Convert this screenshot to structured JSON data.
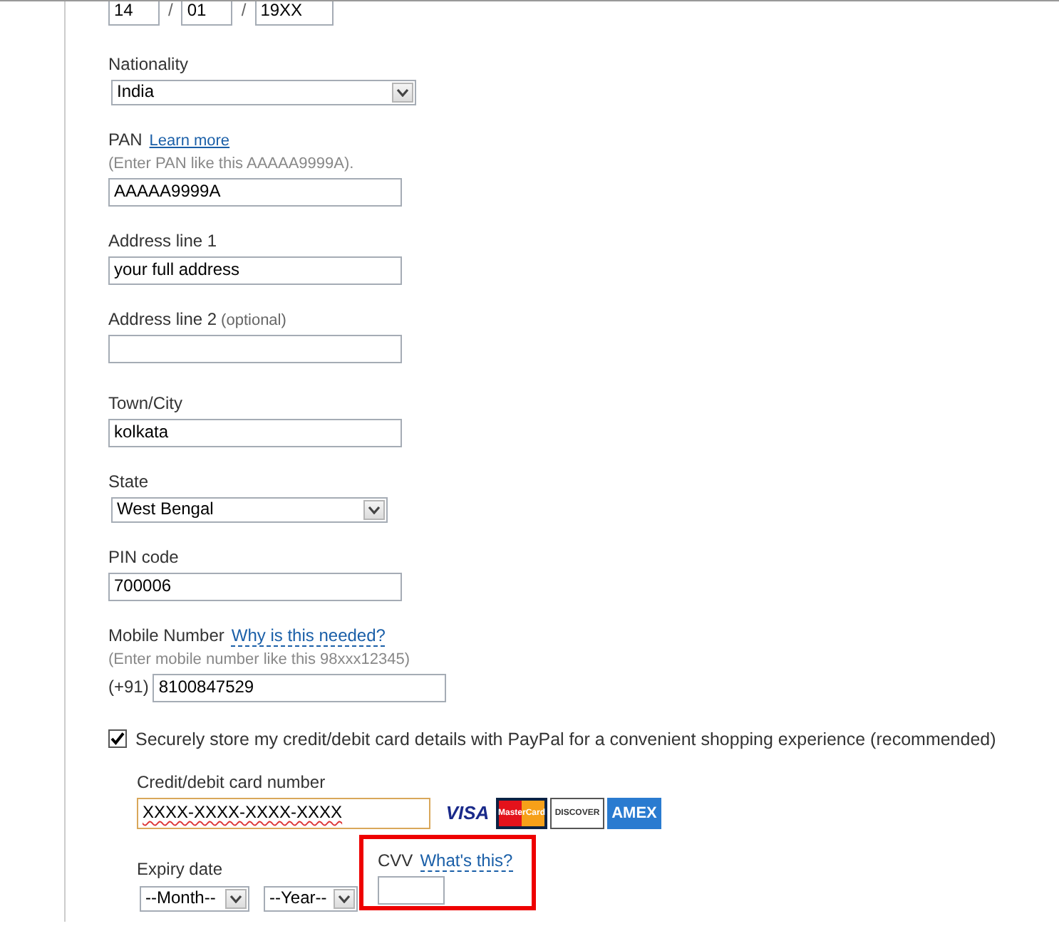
{
  "date_of_birth": {
    "day": "14",
    "month": "01",
    "year": "19XX",
    "separators": [
      "/",
      "/"
    ]
  },
  "fields": [
    {
      "kind": "select",
      "label": "Nationality",
      "value": "India"
    },
    {
      "kind": "text",
      "label": "PAN",
      "link": "Learn more",
      "hint": "(Enter PAN like this AAAAA9999A).",
      "value": "AAAAA9999A"
    },
    {
      "kind": "text",
      "label": "Address line 1",
      "value": "your full address"
    },
    {
      "kind": "text",
      "label": "Address line 2",
      "note": "(optional)"
    },
    {
      "kind": "text",
      "label": "Town/City",
      "value": "kolkata"
    },
    {
      "kind": "select",
      "label": "State",
      "value": "West Bengal"
    },
    {
      "kind": "text",
      "label": "PIN code",
      "value": "700006"
    },
    {
      "kind": "phone",
      "label": "Mobile Number",
      "link": "Why is this needed?",
      "hint": "(Enter mobile number like this 98xxx12345)",
      "prefix": "(+91)",
      "value": "8100847529"
    }
  ],
  "store_card": {
    "checked": true,
    "label": "Securely store my credit/debit card details with PayPal for a convenient shopping experience (recommended)"
  },
  "card": {
    "label": "Credit/debit card number",
    "value": "XXXX-XXXX-XXXX-XXXX",
    "logos": [
      {
        "kind": "visa",
        "text": "VISA"
      },
      {
        "kind": "mastercard",
        "text": "MasterCard"
      },
      {
        "kind": "discover",
        "text": "DISCOVER"
      },
      {
        "kind": "amex",
        "text": "AMEX"
      }
    ],
    "expiry_label": "Expiry date",
    "month": "--Month--",
    "year": "--Year--",
    "cvv_label": "CVV",
    "cvv_link": "What's this?"
  }
}
